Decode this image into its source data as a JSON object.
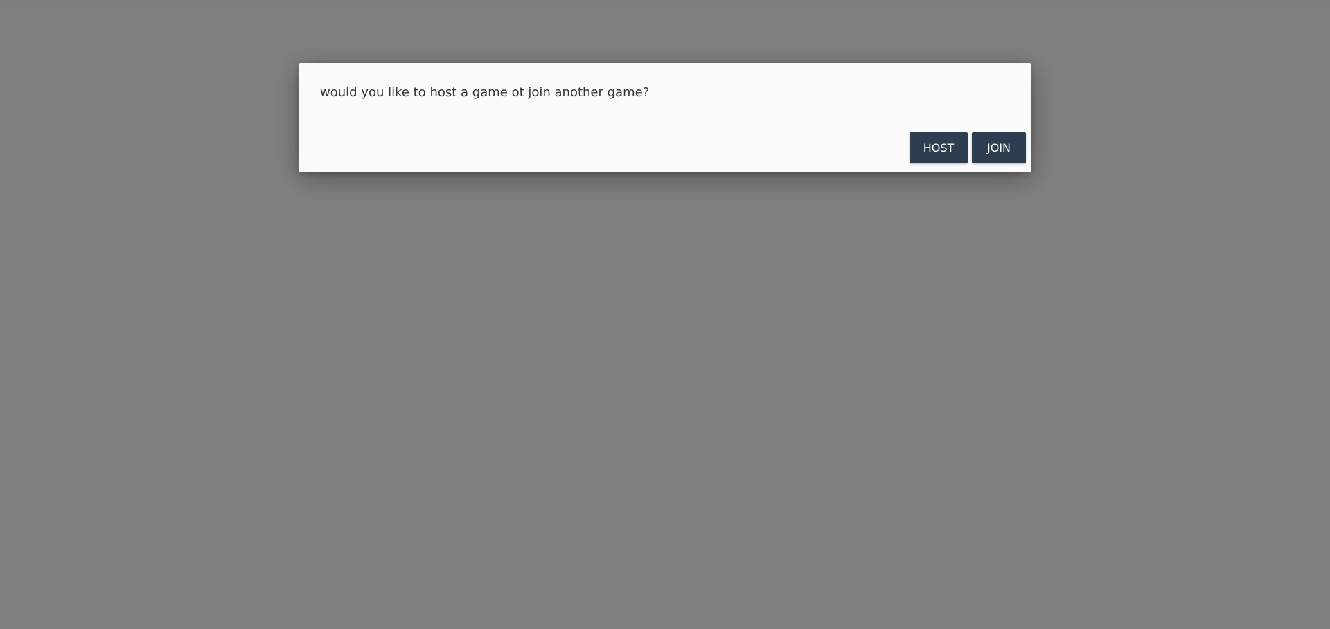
{
  "dialog": {
    "message": "would you like to host a game ot join another game?",
    "host_label": "HOST",
    "join_label": "JOIN"
  },
  "colors": {
    "overlay": "#808080",
    "dialog_background": "#fafafa",
    "button_background": "#2c3e50",
    "button_text": "#ffffff",
    "message_text": "#333333"
  }
}
